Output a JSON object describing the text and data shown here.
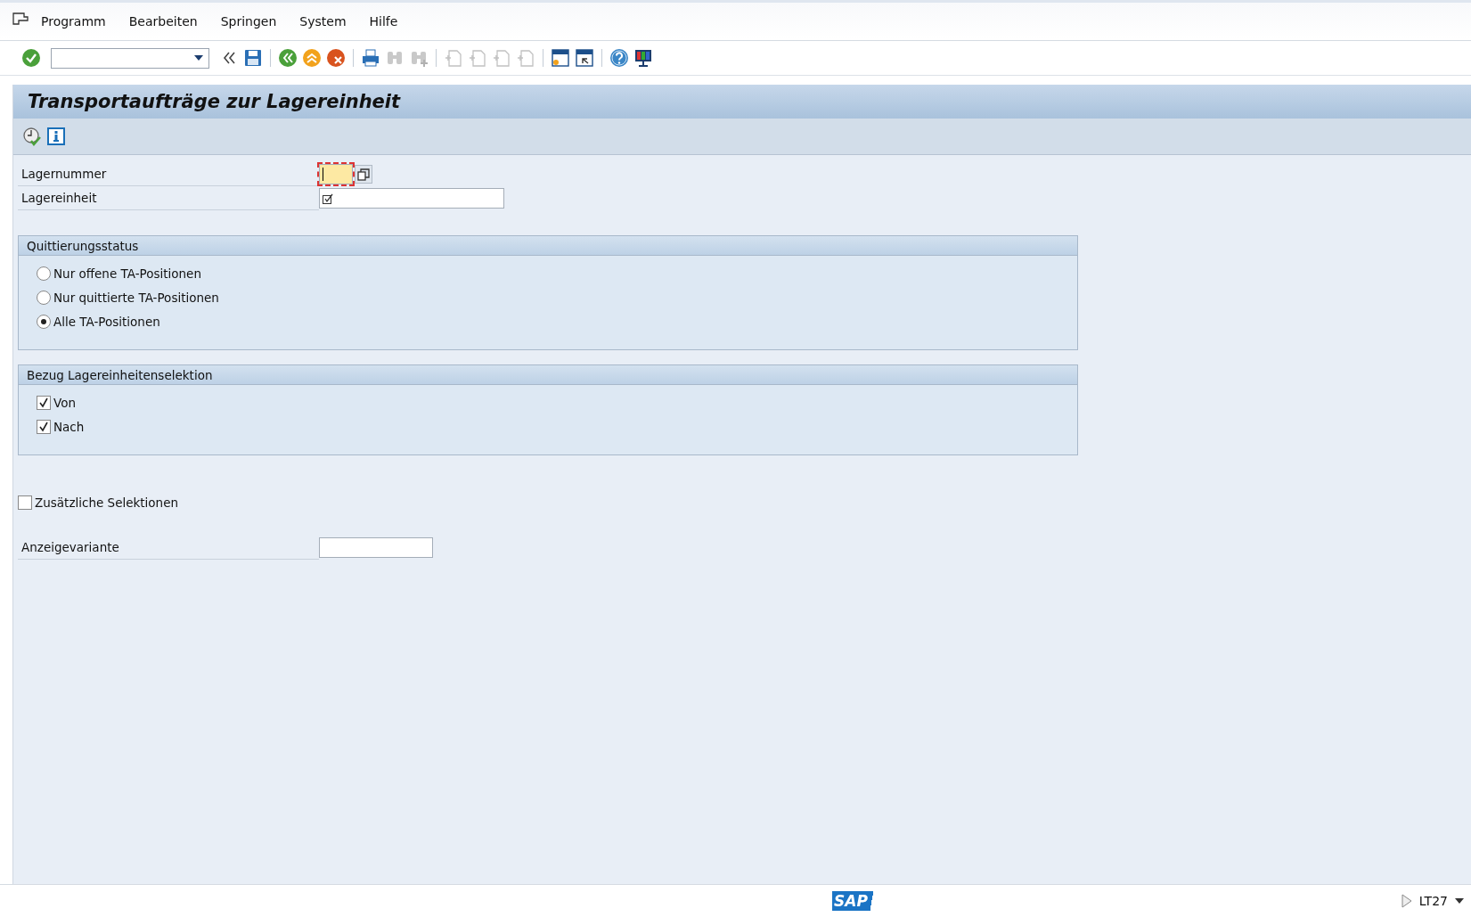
{
  "menu": [
    {
      "label": "Programm"
    },
    {
      "label": "Bearbeiten"
    },
    {
      "label": "Springen"
    },
    {
      "label": "System"
    },
    {
      "label": "Hilfe"
    }
  ],
  "toolbar": [
    {
      "kind": "enter",
      "disabled": false
    },
    {
      "kind": "command-field"
    },
    {
      "kind": "collapse",
      "disabled": false
    },
    {
      "kind": "save",
      "disabled": false
    },
    {
      "kind": "sep"
    },
    {
      "kind": "back",
      "disabled": false
    },
    {
      "kind": "exit",
      "disabled": false
    },
    {
      "kind": "cancel",
      "disabled": false
    },
    {
      "kind": "sep"
    },
    {
      "kind": "print",
      "disabled": false
    },
    {
      "kind": "find",
      "disabled": true
    },
    {
      "kind": "find-next",
      "disabled": true
    },
    {
      "kind": "sep"
    },
    {
      "kind": "first-page",
      "disabled": true
    },
    {
      "kind": "prev-page",
      "disabled": true
    },
    {
      "kind": "next-page",
      "disabled": true
    },
    {
      "kind": "last-page",
      "disabled": true
    },
    {
      "kind": "sep"
    },
    {
      "kind": "new-session",
      "disabled": false
    },
    {
      "kind": "shortcut",
      "disabled": false
    },
    {
      "kind": "sep"
    },
    {
      "kind": "help",
      "disabled": false
    },
    {
      "kind": "layout",
      "disabled": false
    }
  ],
  "title": "Transportaufträge zur Lagereinheit",
  "fields": [
    {
      "label": "Lagernummer",
      "focused": true,
      "required": false,
      "multi": true
    },
    {
      "label": "Lagereinheit",
      "focused": false,
      "required": true,
      "multi": false
    }
  ],
  "groups": [
    {
      "title": "Quittierungsstatus",
      "kind": "radio",
      "options": [
        {
          "label": "Nur offene TA-Positionen",
          "selected": false
        },
        {
          "label": "Nur quittierte TA-Positionen",
          "selected": false
        },
        {
          "label": "Alle TA-Positionen",
          "selected": true
        }
      ]
    },
    {
      "title": "Bezug Lagereinheitenselektion",
      "kind": "checkbox",
      "options": [
        {
          "label": "Von",
          "checked": true
        },
        {
          "label": "Nach",
          "checked": true
        }
      ]
    }
  ],
  "extra": {
    "label": "Zusätzliche Selektionen",
    "checked": false
  },
  "variant": {
    "label": "Anzeigevariante"
  },
  "status_bar": {
    "logo": "SAP",
    "transaction": "LT27"
  }
}
